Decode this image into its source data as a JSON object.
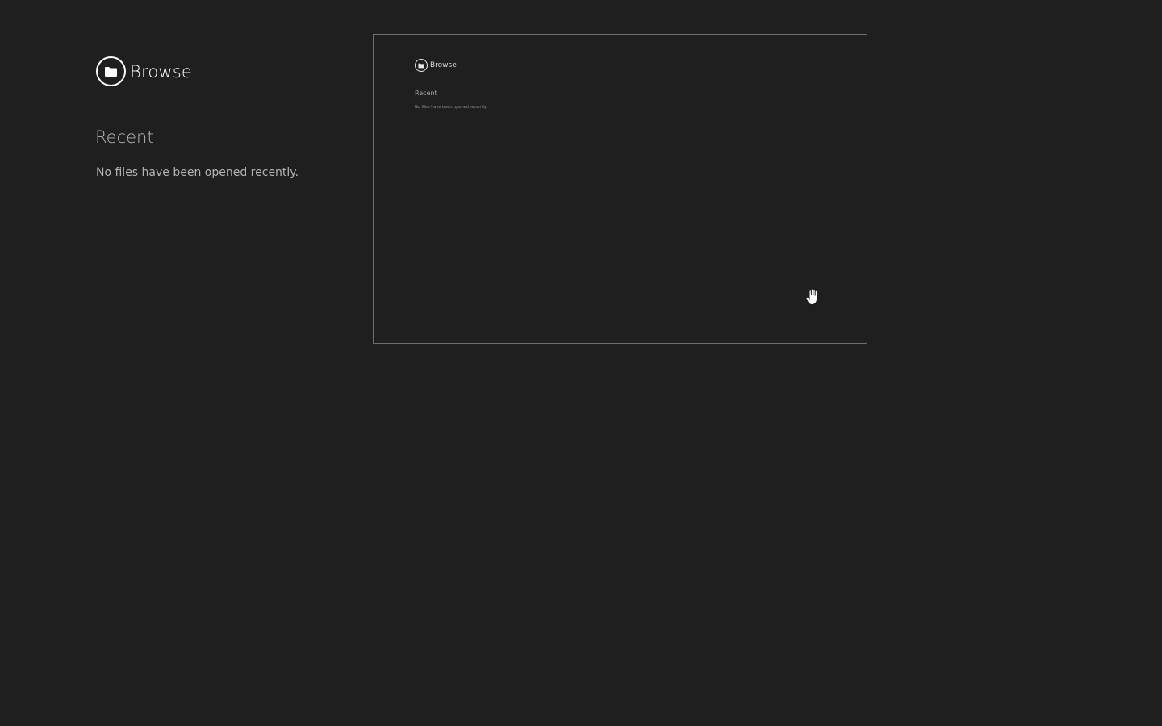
{
  "browse": {
    "label": "Browse",
    "icon": "folder-icon"
  },
  "recent": {
    "heading": "Recent",
    "empty_message": "No files have been opened recently."
  },
  "preview": {
    "browse_label": "Browse",
    "recent_heading": "Recent",
    "empty_message": "No files have been opened recently.",
    "cursor_icon": "hand-cursor-icon"
  },
  "colors": {
    "background": "#1f1f1f",
    "foreground": "#ffffff",
    "muted_text": "#b3b3b3",
    "preview_border": "#6e6e6e"
  }
}
